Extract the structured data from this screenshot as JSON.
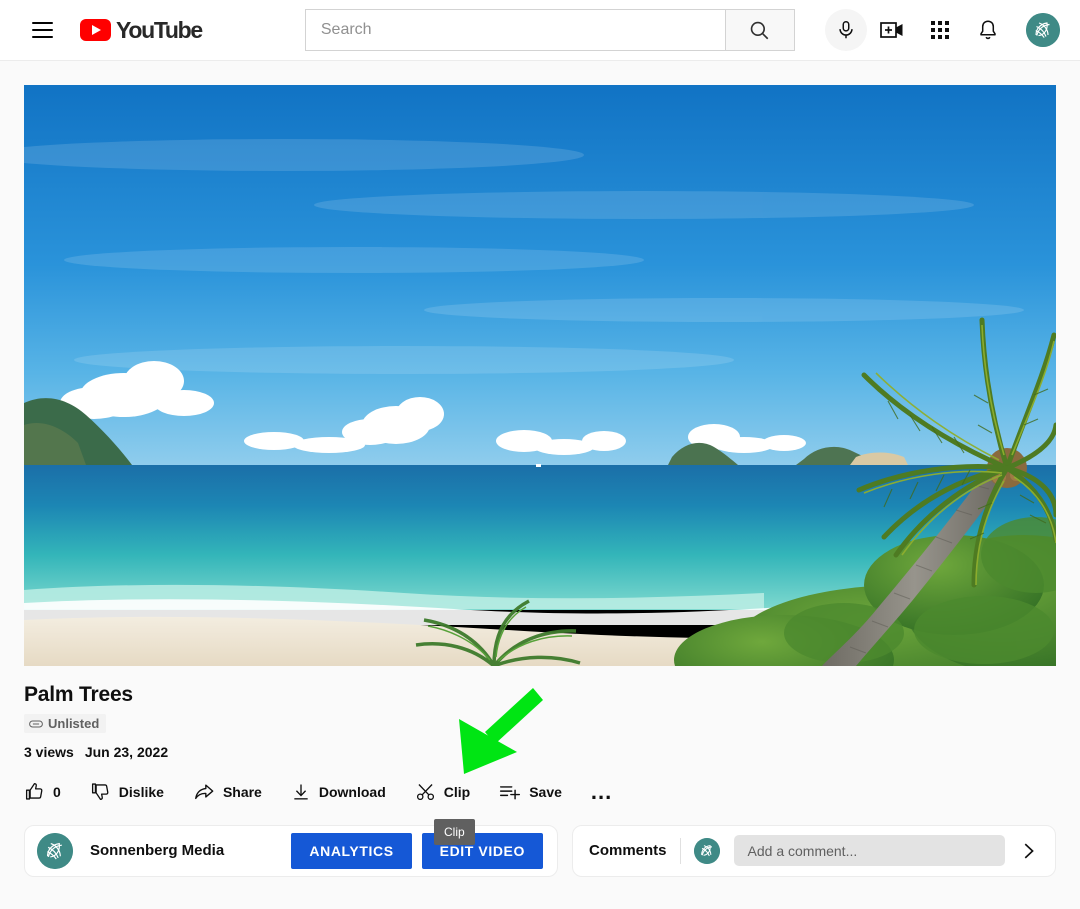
{
  "header": {
    "menu_icon": "hamburger-menu-icon",
    "logo_text": "YouTube",
    "search": {
      "placeholder": "Search",
      "value": "",
      "search_icon": "search-icon"
    },
    "mic_icon": "microphone-icon",
    "icons": [
      {
        "name": "create-video-icon",
        "label": "Create"
      },
      {
        "name": "apps-grid-icon",
        "label": "YouTube apps"
      },
      {
        "name": "bell-icon",
        "label": "Notifications"
      }
    ],
    "avatar": {
      "name": "account-avatar",
      "color": "#3F8A86"
    }
  },
  "video": {
    "title": "Palm Trees",
    "privacy_badge": {
      "icon": "link-icon",
      "label": "Unlisted"
    },
    "views": "3 views",
    "date": "Jun 23, 2022",
    "thumbnail_alt": "Tropical beach with palm tree over turquoise water"
  },
  "actions": [
    {
      "name": "like-button",
      "icon": "thumbs-up-icon",
      "label": "0"
    },
    {
      "name": "dislike-button",
      "icon": "thumbs-down-icon",
      "label": "Dislike"
    },
    {
      "name": "share-button",
      "icon": "share-arrow-icon",
      "label": "Share"
    },
    {
      "name": "download-button",
      "icon": "download-icon",
      "label": "Download"
    },
    {
      "name": "clip-button",
      "icon": "scissors-icon",
      "label": "Clip"
    },
    {
      "name": "save-button",
      "icon": "save-playlist-icon",
      "label": "Save"
    },
    {
      "name": "more-actions-button",
      "icon": "ellipsis-icon",
      "label": "..."
    }
  ],
  "annotation": {
    "arrow_color": "#00E513",
    "points_to": "clip-button"
  },
  "tooltip": {
    "label": "Clip"
  },
  "channel_bar": {
    "avatar": {
      "name": "channel-avatar",
      "color": "#3F8A86"
    },
    "name": "Sonnenberg Media",
    "analytics_label": "ANALYTICS",
    "edit_video_label": "EDIT VIDEO",
    "button_color": "#1558D6"
  },
  "comments_bar": {
    "label": "Comments",
    "avatar": {
      "name": "comment-avatar",
      "color": "#3F8A86"
    },
    "input_placeholder": "Add a comment...",
    "input_value": "",
    "expand_icon": "chevron-right-icon"
  }
}
